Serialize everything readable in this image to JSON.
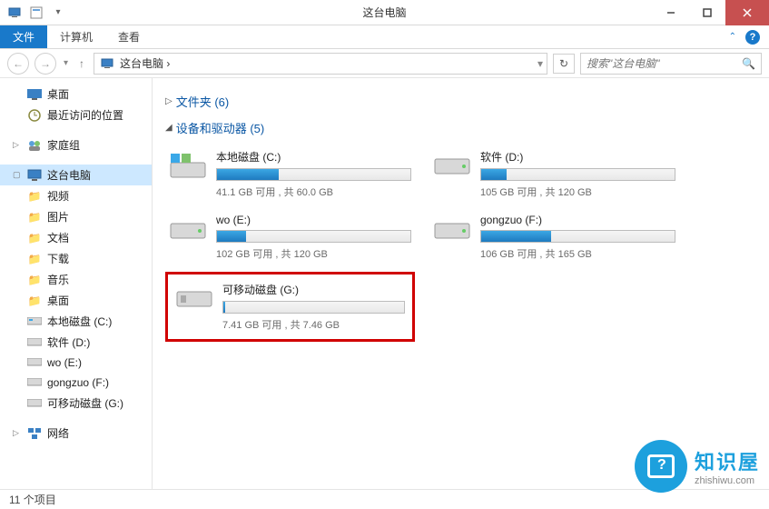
{
  "window": {
    "title": "这台电脑"
  },
  "ribbon": {
    "file": "文件",
    "computer": "计算机",
    "view": "查看"
  },
  "nav": {
    "breadcrumb": "这台电脑 ›",
    "search_placeholder": "搜索\"这台电脑\""
  },
  "sidebar": {
    "favorites": [
      {
        "label": "桌面",
        "icon": "desktop"
      },
      {
        "label": "最近访问的位置",
        "icon": "recent"
      }
    ],
    "homegroup": "家庭组",
    "thispc": "这台电脑",
    "thispc_children": [
      {
        "label": "视频",
        "icon": "folder"
      },
      {
        "label": "图片",
        "icon": "folder"
      },
      {
        "label": "文档",
        "icon": "folder"
      },
      {
        "label": "下载",
        "icon": "folder"
      },
      {
        "label": "音乐",
        "icon": "folder"
      },
      {
        "label": "桌面",
        "icon": "folder"
      },
      {
        "label": "本地磁盘 (C:)",
        "icon": "drive"
      },
      {
        "label": "软件 (D:)",
        "icon": "drive"
      },
      {
        "label": "wo (E:)",
        "icon": "drive"
      },
      {
        "label": "gongzuo (F:)",
        "icon": "drive"
      },
      {
        "label": "可移动磁盘 (G:)",
        "icon": "usb"
      }
    ],
    "network": "网络"
  },
  "main": {
    "folders_header": "文件夹 (6)",
    "devices_header": "设备和驱动器 (5)",
    "drives": [
      {
        "name": "本地磁盘 (C:)",
        "info": "41.1 GB 可用 , 共 60.0 GB",
        "fill_pct": 32,
        "icon": "c"
      },
      {
        "name": "软件 (D:)",
        "info": "105 GB 可用 , 共 120 GB",
        "fill_pct": 13,
        "icon": "hdd"
      },
      {
        "name": "wo (E:)",
        "info": "102 GB 可用 , 共 120 GB",
        "fill_pct": 15,
        "icon": "hdd"
      },
      {
        "name": "gongzuo (F:)",
        "info": "106 GB 可用 , 共 165 GB",
        "fill_pct": 36,
        "icon": "hdd"
      },
      {
        "name": "可移动磁盘 (G:)",
        "info": "7.41 GB 可用 , 共 7.46 GB",
        "fill_pct": 1,
        "icon": "usb",
        "highlighted": true
      }
    ]
  },
  "statusbar": {
    "items": "11 个项目"
  },
  "watermark": {
    "title": "知识屋",
    "url": "zhishiwu.com"
  }
}
